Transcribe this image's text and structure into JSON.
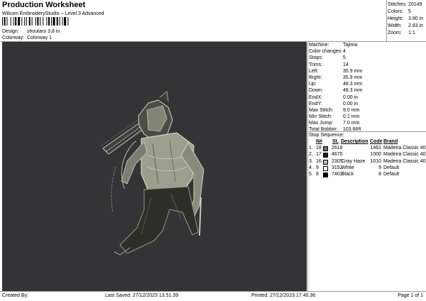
{
  "header": {
    "title": "Production Worksheet",
    "subtitle": "Wilcom EmbroideryStudio – Level 3 Advanced"
  },
  "design": {
    "label": "Design:",
    "value": "shoutaro 3,8 in"
  },
  "colorway": {
    "label": "Colorway:",
    "value": "Colorway 1"
  },
  "stats": [
    {
      "label": "Stitches:",
      "value": "20149"
    },
    {
      "label": "Colors:",
      "value": "5"
    },
    {
      "label": "Height:",
      "value": "3.80 in"
    },
    {
      "label": "Width:",
      "value": "2.83 in"
    },
    {
      "label": "Zoom:",
      "value": "1:1"
    }
  ],
  "machine": [
    {
      "label": "Machine:",
      "value": "Tajima"
    },
    {
      "label": "Color changes:",
      "value": "4"
    },
    {
      "label": "Stops:",
      "value": "5"
    },
    {
      "label": "Trims:",
      "value": "14"
    },
    {
      "label": "Left:",
      "value": "35.9 mm"
    },
    {
      "label": "Right:",
      "value": "35.9 mm"
    },
    {
      "label": "Up:",
      "value": "48.3 mm"
    },
    {
      "label": "Down:",
      "value": "48.3 mm"
    },
    {
      "label": "EndX:",
      "value": "0.00 in"
    },
    {
      "label": "EndY:",
      "value": "0.00 in"
    },
    {
      "label": "Max Stitch:",
      "value": "9.0 mm"
    },
    {
      "label": "Min Stitch:",
      "value": "0.1 mm"
    },
    {
      "label": "Max Jump:",
      "value": "7.0 mm"
    },
    {
      "label": "Total Bobbin:",
      "value": "103.66ft"
    }
  ],
  "stop_sequence": {
    "title": "Stop Sequence:",
    "headers": {
      "num": "N#",
      "st": "St.",
      "description": "Description",
      "code": "Code",
      "brand": "Brand"
    },
    "rows": [
      {
        "stop": "1.",
        "num": "18",
        "color": "#6e6e6e",
        "st": "2618",
        "description": "",
        "code": "1461",
        "brand": "Madeira Classic 40"
      },
      {
        "stop": "2.",
        "num": "17",
        "color": "#1e1e1e",
        "st": "4670",
        "description": "",
        "code": "1000",
        "brand": "Madeira Classic 40"
      },
      {
        "stop": "3.",
        "num": "16",
        "color": "#b9b9b4",
        "st": "2305",
        "description": "Gray Haze",
        "code": "1010",
        "brand": "Madeira Classic 40"
      },
      {
        "stop": "4.",
        "num": "9",
        "color": "#ffffff",
        "st": "3152",
        "description": "White",
        "code": "9",
        "brand": "Default"
      },
      {
        "stop": "5.",
        "num": "8",
        "color": "#000000",
        "st": "7402",
        "description": "Black",
        "code": "8",
        "brand": "Default"
      }
    ]
  },
  "footer": {
    "created_by": "Created By:",
    "last_saved": "Last Saved: 27/12/2023 13.51.39",
    "printed": "Printed: 27/12/2023 17.40.36",
    "page": "Page 1 of 1"
  },
  "colors": {
    "canvas_bg": "#333435"
  }
}
